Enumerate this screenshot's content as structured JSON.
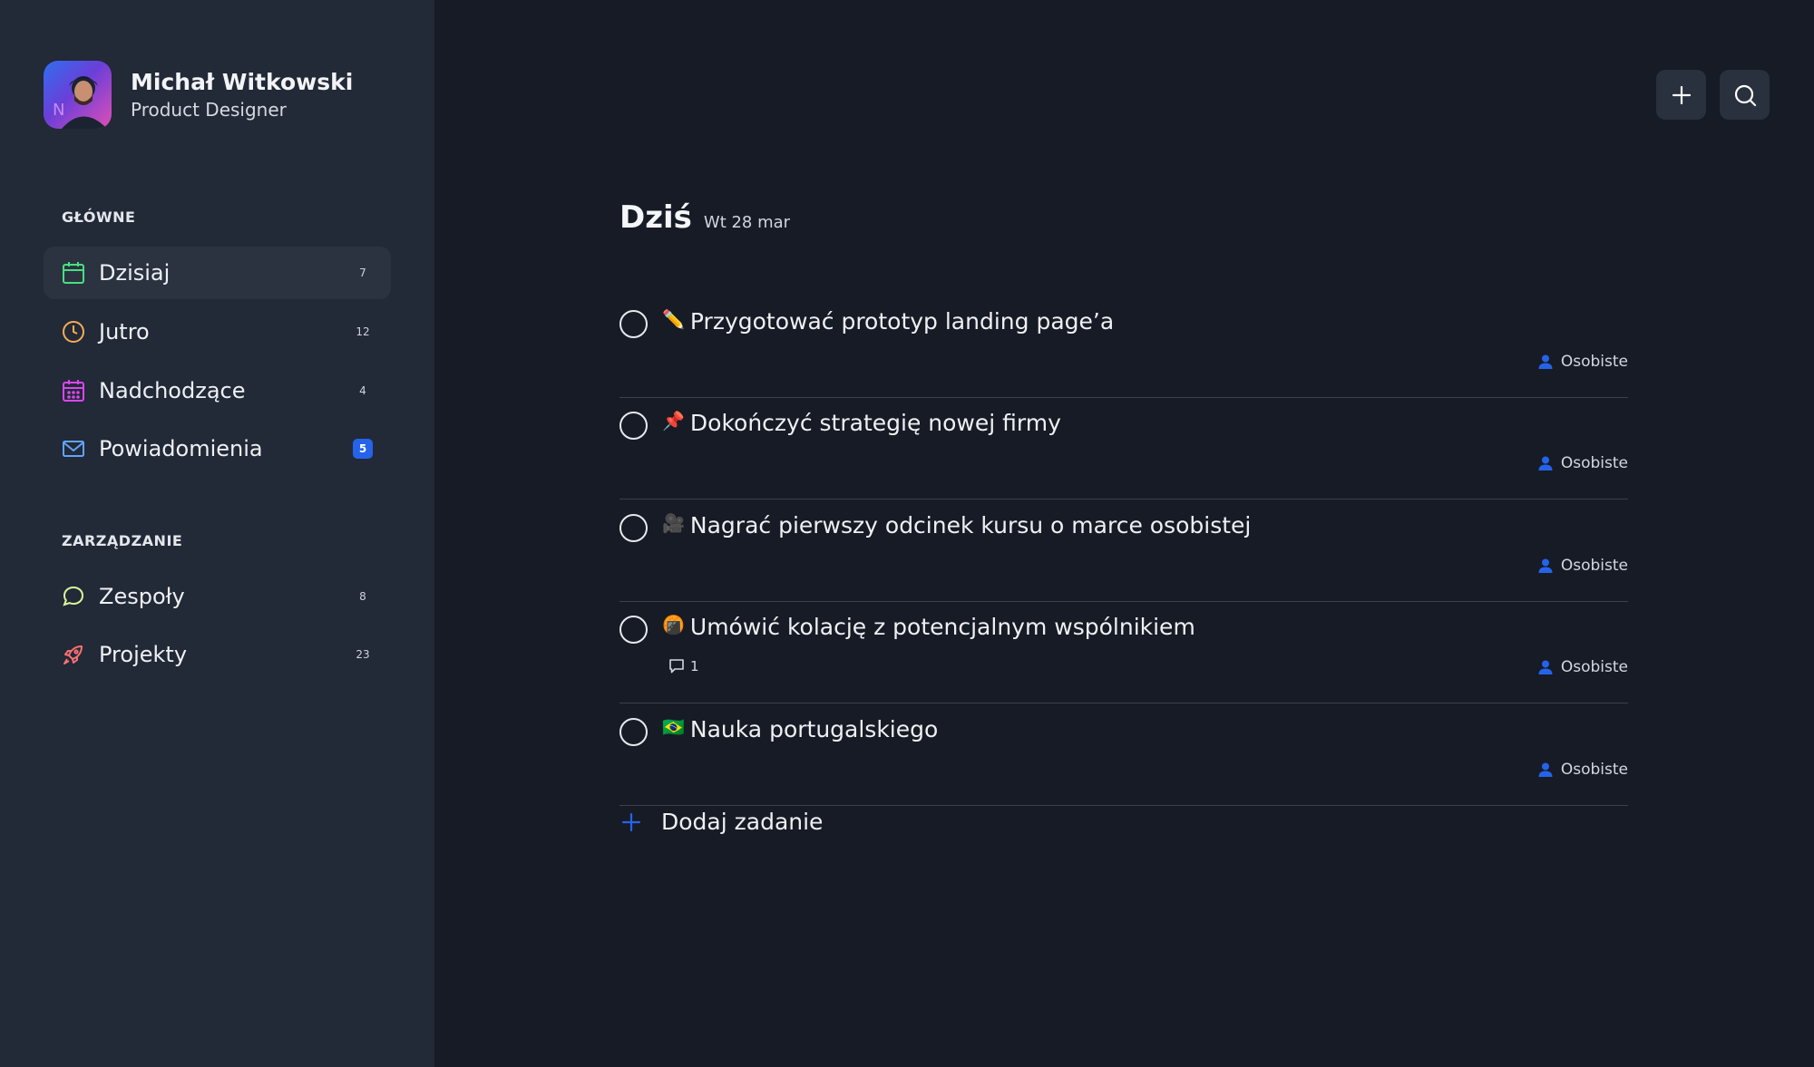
{
  "profile": {
    "name": "Michał Witkowski",
    "role": "Product Designer"
  },
  "sidebar": {
    "main_section": "GŁÓWNE",
    "main_items": [
      {
        "label": "Dzisiaj",
        "count": "7",
        "icon": "calendar-icon",
        "color": "#4ade80"
      },
      {
        "label": "Jutro",
        "count": "12",
        "icon": "clock-icon",
        "color": "#f6ad55"
      },
      {
        "label": "Nadchodzące",
        "count": "4",
        "icon": "calendar-grid-icon",
        "color": "#d946ef"
      },
      {
        "label": "Powiadomienia",
        "count": "5",
        "icon": "mail-icon",
        "color": "#60a5fa"
      }
    ],
    "manage_section": "ZARZĄDZANIE",
    "manage_items": [
      {
        "label": "Zespoły",
        "count": "8",
        "icon": "chat-bubble-icon",
        "color": "#d9f99d"
      },
      {
        "label": "Projekty",
        "count": "23",
        "icon": "rocket-icon",
        "color": "#f87171"
      }
    ]
  },
  "main": {
    "title": "Dziś",
    "date": "Wt 28 mar",
    "tasks": [
      {
        "emoji": "✏️",
        "title": "Przygotować prototyp landing page’a",
        "tag": "Osobiste"
      },
      {
        "emoji": "📌",
        "title": "Dokończyć strategię nowej firmy",
        "tag": "Osobiste"
      },
      {
        "emoji": "🎥",
        "title": "Nagrać pierwszy odcinek kursu o marce osobistej",
        "tag": "Osobiste"
      },
      {
        "emoji": "🍘",
        "title": "Umówić kolację z potencjalnym wspólnikiem",
        "tag": "Osobiste",
        "comments": "1"
      },
      {
        "emoji": "🇧🇷",
        "title": "Nauka portugalskiego",
        "tag": "Osobiste"
      }
    ],
    "add_task_label": "Dodaj zadanie"
  },
  "colors": {
    "accent": "#2563eb",
    "sidebar_bg": "#222937",
    "main_bg": "#161b25"
  }
}
